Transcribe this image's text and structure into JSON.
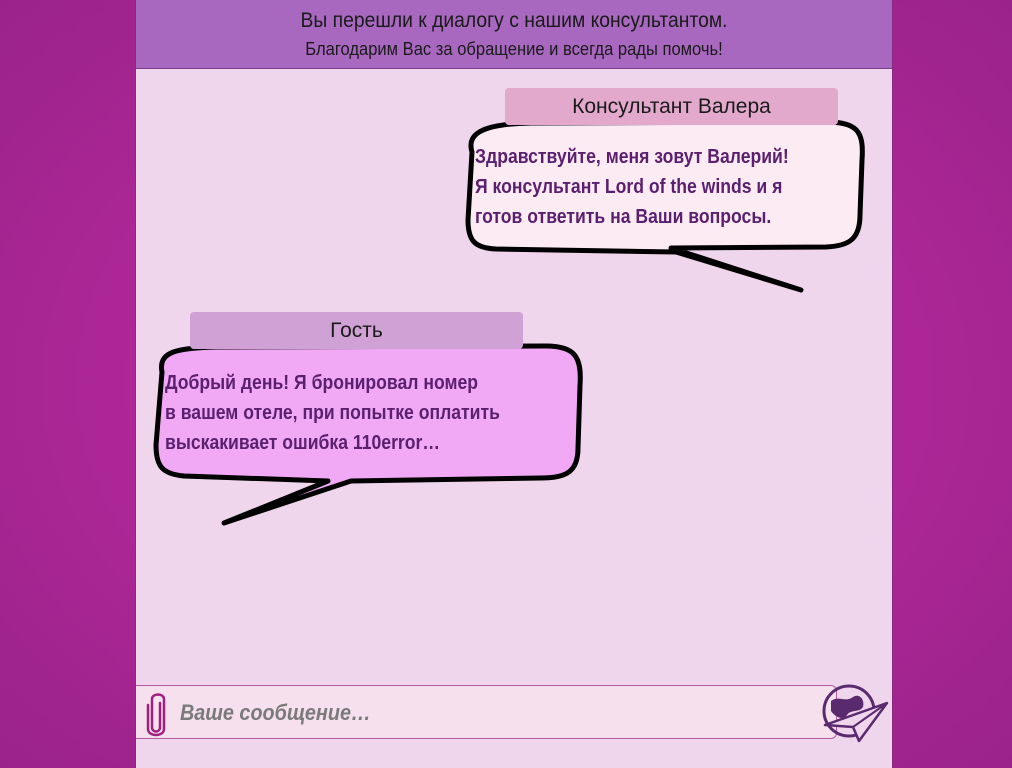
{
  "header": {
    "line1": "Вы перешли к диалогу с нашим консультантом.",
    "line2": "Благодарим Вас за обращение и всегда рады помочь!"
  },
  "messages": [
    {
      "author": "Консультант Валера",
      "lines": [
        "Здравствуйте, меня зовут Валерий!",
        "Я консультант Lord of the winds и я",
        "готов ответить на Ваши вопросы."
      ],
      "bubble_color": "#fdebf4"
    },
    {
      "author": "Гость",
      "lines": [
        "Добрый день! Я бронировал номер",
        "в вашем отеле, при попытке оплатить",
        "выскакивает ошибка 110error…"
      ],
      "bubble_color": "#f1a9f6"
    }
  ],
  "input": {
    "placeholder": "Ваше сообщение…"
  },
  "icons": {
    "attach": "paperclip-icon",
    "send": "send-paper-plane-globe-icon"
  },
  "colors": {
    "background": "#b5289e",
    "panel": "#f0d6ec",
    "header": "#a968c0",
    "text_accent": "#5a1f6e"
  }
}
